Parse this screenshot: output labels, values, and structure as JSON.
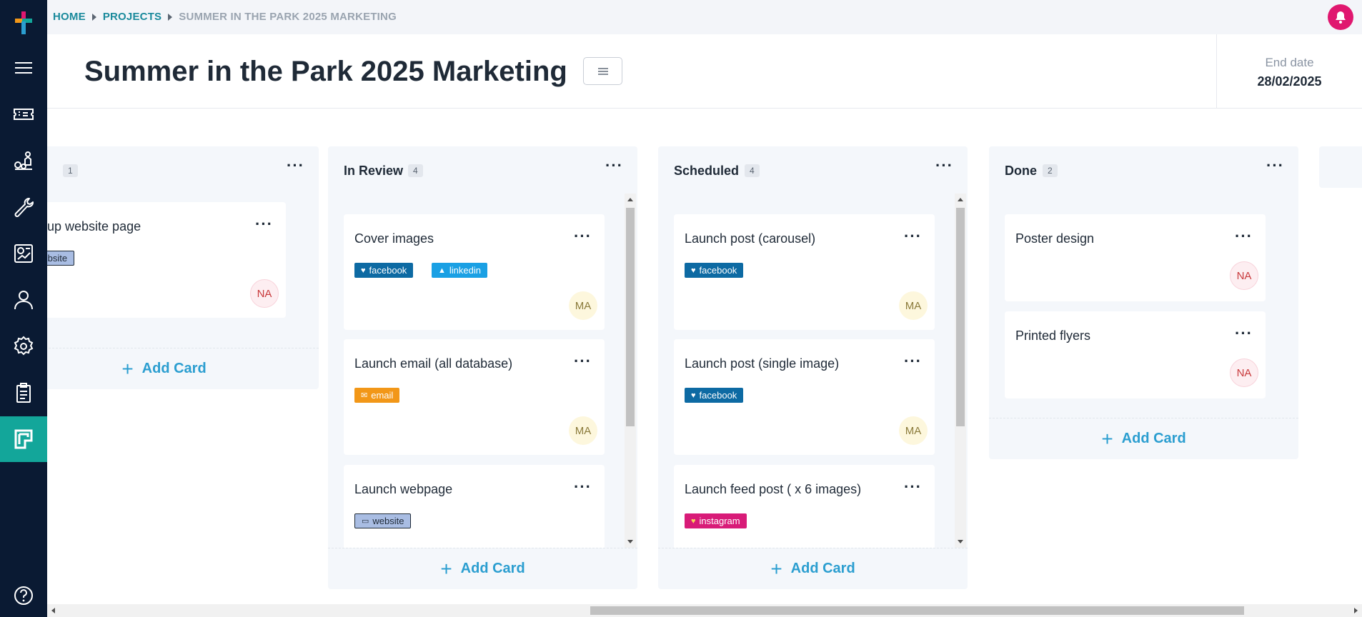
{
  "breadcrumb": {
    "home": "HOME",
    "projects": "PROJECTS",
    "current": "SUMMER IN THE PARK 2025 MARKETING"
  },
  "header": {
    "title": "Summer in the Park 2025 Marketing",
    "end_date_label": "End date",
    "end_date_value": "28/02/2025"
  },
  "sidebar": {
    "items": [
      {
        "icon": "hamburger-icon"
      },
      {
        "icon": "ticket-icon"
      },
      {
        "icon": "people-icon"
      },
      {
        "icon": "wrench-icon"
      },
      {
        "icon": "report-icon"
      },
      {
        "icon": "user-icon"
      },
      {
        "icon": "gear-icon"
      },
      {
        "icon": "clipboard-icon"
      },
      {
        "icon": "board-icon",
        "active": true
      },
      {
        "icon": "help-icon"
      }
    ]
  },
  "columns": [
    {
      "title": "",
      "count": "1",
      "cards": [
        {
          "title": "e-up website page",
          "tags": [
            {
              "label": "website",
              "type": "website"
            }
          ],
          "avatar": "NA"
        }
      ],
      "add_label": "Add Card"
    },
    {
      "title": "In Review",
      "count": "4",
      "cards": [
        {
          "title": "Cover images",
          "tags": [
            {
              "label": "facebook",
              "type": "facebook"
            },
            {
              "label": "linkedin",
              "type": "linkedin"
            }
          ],
          "avatar": "MA"
        },
        {
          "title": "Launch email (all database)",
          "tags": [
            {
              "label": "email",
              "type": "email"
            }
          ],
          "avatar": "MA"
        },
        {
          "title": "Launch webpage",
          "tags": [
            {
              "label": "website",
              "type": "website"
            }
          ],
          "avatar": ""
        }
      ],
      "add_label": "Add Card"
    },
    {
      "title": "Scheduled",
      "count": "4",
      "cards": [
        {
          "title": "Launch post (carousel)",
          "tags": [
            {
              "label": "facebook",
              "type": "facebook"
            }
          ],
          "avatar": "MA"
        },
        {
          "title": "Launch post (single image)",
          "tags": [
            {
              "label": "facebook",
              "type": "facebook"
            }
          ],
          "avatar": "MA"
        },
        {
          "title": "Launch feed post ( x 6 images)",
          "tags": [
            {
              "label": "instagram",
              "type": "instagram"
            }
          ],
          "avatar": ""
        }
      ],
      "add_label": "Add Card"
    },
    {
      "title": "Done",
      "count": "2",
      "cards": [
        {
          "title": "Poster design",
          "tags": [],
          "avatar": "NA"
        },
        {
          "title": "Printed flyers",
          "tags": [],
          "avatar": "NA"
        }
      ],
      "add_label": "Add Card"
    }
  ],
  "colors": {
    "sidebar": "#0a1a33",
    "accent": "#13a69a",
    "link": "#1a8a9c",
    "add": "#2b9ed0",
    "bell": "#e0176f"
  }
}
